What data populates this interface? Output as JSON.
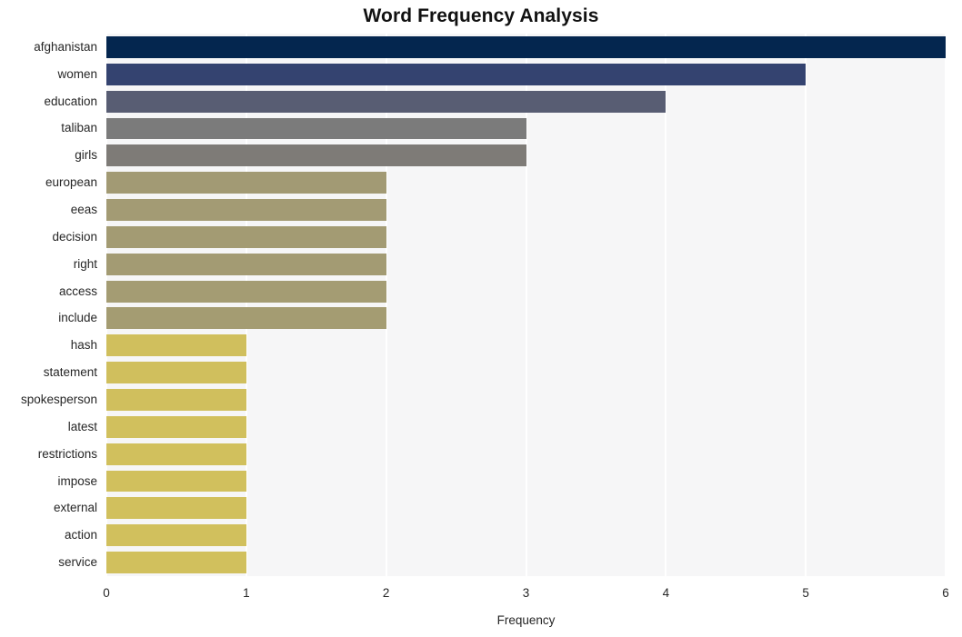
{
  "chart_data": {
    "type": "bar",
    "orientation": "horizontal",
    "title": "Word Frequency Analysis",
    "xlabel": "Frequency",
    "ylabel": "",
    "xlim": [
      0,
      6
    ],
    "ylim": [
      0,
      20
    ],
    "grid": true,
    "legend": null,
    "x_ticks": [
      "0",
      "1",
      "2",
      "3",
      "4",
      "5",
      "6"
    ],
    "x_tick_values": [
      0,
      1,
      2,
      3,
      4,
      5,
      6
    ],
    "categories": [
      "afghanistan",
      "women",
      "education",
      "taliban",
      "girls",
      "european",
      "eeas",
      "decision",
      "right",
      "access",
      "include",
      "hash",
      "statement",
      "spokesperson",
      "latest",
      "restrictions",
      "impose",
      "external",
      "action",
      "service"
    ],
    "values": [
      6,
      5,
      4,
      3,
      3,
      2,
      2,
      2,
      2,
      2,
      2,
      1,
      1,
      1,
      1,
      1,
      1,
      1,
      1,
      1
    ],
    "bar_colors": [
      "#04264f",
      "#344370",
      "#585d73",
      "#7b7b7b",
      "#7e7b77",
      "#a29a74",
      "#a39b74",
      "#a39b73",
      "#a39b73",
      "#a49c73",
      "#a49c72",
      "#d0bf5d",
      "#d0bf5d",
      "#d0bf5d",
      "#d1c05d",
      "#d1c05d",
      "#d1c05d",
      "#d1c05d",
      "#d1c05d",
      "#d1c05d"
    ]
  },
  "style": {
    "plot_background": "#f6f6f7",
    "figure_background": "#ffffff",
    "gridline_color": "#ffffff",
    "text_color": "#262626",
    "title_color": "#111111"
  }
}
